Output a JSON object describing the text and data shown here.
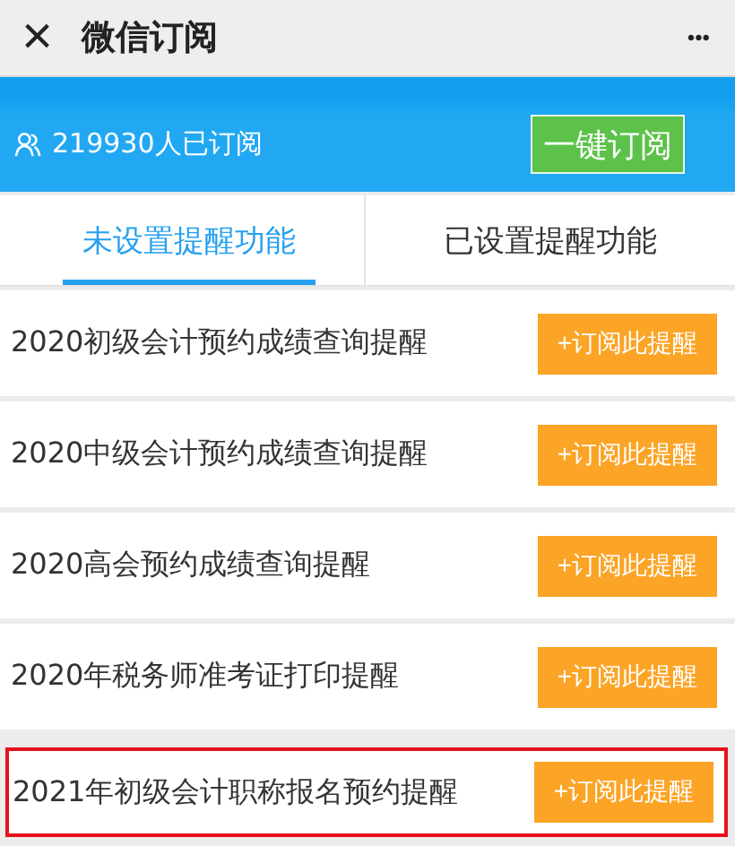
{
  "window": {
    "title": "微信订阅",
    "close": "×",
    "more": "•••"
  },
  "banner": {
    "subscribers": "219930人已订阅",
    "subscribe_all": "一键订阅"
  },
  "tabs": [
    {
      "label": "未设置提醒功能",
      "selected": true
    },
    {
      "label": "已设置提醒功能",
      "selected": false
    }
  ],
  "reminders": [
    {
      "title": "2020初级会计预约成绩查询提醒",
      "button": "+订阅此提醒",
      "highlighted": false
    },
    {
      "title": "2020中级会计预约成绩查询提醒",
      "button": "+订阅此提醒",
      "highlighted": false
    },
    {
      "title": "2020高会预约成绩查询提醒",
      "button": "+订阅此提醒",
      "highlighted": false
    },
    {
      "title": "2020年税务师准考证打印提醒",
      "button": "+订阅此提醒",
      "highlighted": false
    },
    {
      "title": "2021年初级会计职称报名预约提醒",
      "button": "+订阅此提醒",
      "highlighted": true
    }
  ]
}
